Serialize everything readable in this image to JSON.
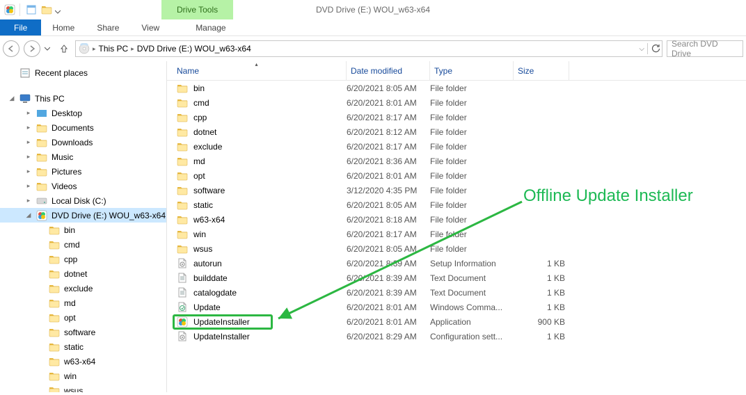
{
  "title": "DVD Drive (E:) WOU_w63-x64",
  "context_tab": "Drive Tools",
  "ribbon": {
    "file": "File",
    "home": "Home",
    "share": "Share",
    "view": "View",
    "manage": "Manage"
  },
  "breadcrumb": {
    "root": "This PC",
    "leaf": "DVD Drive (E:) WOU_w63-x64"
  },
  "search_placeholder": "Search DVD Drive",
  "nav": {
    "recent": "Recent places",
    "thispc": "This PC",
    "desktop": "Desktop",
    "documents": "Documents",
    "downloads": "Downloads",
    "music": "Music",
    "pictures": "Pictures",
    "videos": "Videos",
    "localdisk": "Local Disk (C:)",
    "dvd": "DVD Drive (E:) WOU_w63-x64",
    "subs": [
      "bin",
      "cmd",
      "cpp",
      "dotnet",
      "exclude",
      "md",
      "opt",
      "software",
      "static",
      "w63-x64",
      "win",
      "wsus"
    ]
  },
  "cols": {
    "name": "Name",
    "date": "Date modified",
    "type": "Type",
    "size": "Size"
  },
  "files": [
    {
      "icon": "folder",
      "name": "bin",
      "date": "6/20/2021 8:05 AM",
      "type": "File folder",
      "size": ""
    },
    {
      "icon": "folder",
      "name": "cmd",
      "date": "6/20/2021 8:01 AM",
      "type": "File folder",
      "size": ""
    },
    {
      "icon": "folder",
      "name": "cpp",
      "date": "6/20/2021 8:17 AM",
      "type": "File folder",
      "size": ""
    },
    {
      "icon": "folder",
      "name": "dotnet",
      "date": "6/20/2021 8:12 AM",
      "type": "File folder",
      "size": ""
    },
    {
      "icon": "folder",
      "name": "exclude",
      "date": "6/20/2021 8:17 AM",
      "type": "File folder",
      "size": ""
    },
    {
      "icon": "folder",
      "name": "md",
      "date": "6/20/2021 8:36 AM",
      "type": "File folder",
      "size": ""
    },
    {
      "icon": "folder",
      "name": "opt",
      "date": "6/20/2021 8:01 AM",
      "type": "File folder",
      "size": ""
    },
    {
      "icon": "folder",
      "name": "software",
      "date": "3/12/2020 4:35 PM",
      "type": "File folder",
      "size": ""
    },
    {
      "icon": "folder",
      "name": "static",
      "date": "6/20/2021 8:05 AM",
      "type": "File folder",
      "size": ""
    },
    {
      "icon": "folder",
      "name": "w63-x64",
      "date": "6/20/2021 8:18 AM",
      "type": "File folder",
      "size": ""
    },
    {
      "icon": "folder",
      "name": "win",
      "date": "6/20/2021 8:17 AM",
      "type": "File folder",
      "size": ""
    },
    {
      "icon": "folder",
      "name": "wsus",
      "date": "6/20/2021 8:05 AM",
      "type": "File folder",
      "size": ""
    },
    {
      "icon": "ini",
      "name": "autorun",
      "date": "6/20/2021 8:39 AM",
      "type": "Setup Information",
      "size": "1 KB"
    },
    {
      "icon": "txt",
      "name": "builddate",
      "date": "6/20/2021 8:39 AM",
      "type": "Text Document",
      "size": "1 KB"
    },
    {
      "icon": "txt",
      "name": "catalogdate",
      "date": "6/20/2021 8:39 AM",
      "type": "Text Document",
      "size": "1 KB"
    },
    {
      "icon": "cmd",
      "name": "Update",
      "date": "6/20/2021 8:01 AM",
      "type": "Windows Comma...",
      "size": "1 KB"
    },
    {
      "icon": "app",
      "name": "UpdateInstaller",
      "date": "6/20/2021 8:01 AM",
      "type": "Application",
      "size": "900 KB"
    },
    {
      "icon": "ini",
      "name": "UpdateInstaller",
      "date": "6/20/2021 8:29 AM",
      "type": "Configuration sett...",
      "size": "1 KB"
    }
  ],
  "annotation": "Offline Update Installer"
}
